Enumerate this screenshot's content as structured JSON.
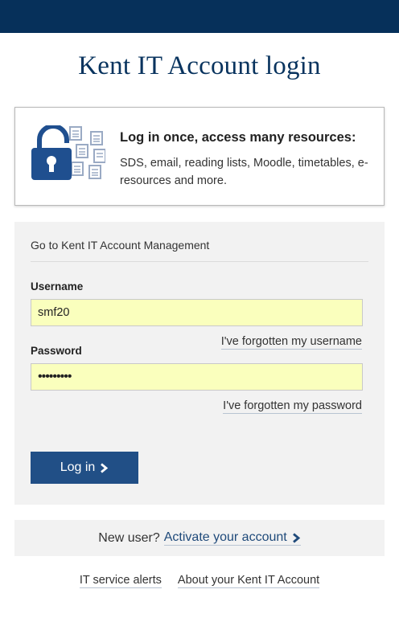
{
  "header": {
    "title": "Kent IT Account login"
  },
  "info": {
    "heading": "Log in once, access many resources:",
    "text": "SDS, email, reading lists, Moodle, timetables, e-resources and more.",
    "icon": "padlock-documents-icon"
  },
  "form": {
    "management_link": "Go to Kent IT Account Management",
    "username_label": "Username",
    "username_value": "smf20",
    "forgot_username": "I've forgotten my username",
    "password_label": "Password",
    "password_value": "•••••••••",
    "forgot_password": "I've forgotten my password",
    "login_label": "Log in"
  },
  "new_user": {
    "prompt": "New user?",
    "activate_label": "Activate your account"
  },
  "footer": {
    "alerts_label": "IT service alerts",
    "about_label": "About your Kent IT Account"
  },
  "colors": {
    "brand": "#06305a",
    "button": "#214f86",
    "autofill": "#faffbd",
    "panel": "#f2f2f2"
  }
}
